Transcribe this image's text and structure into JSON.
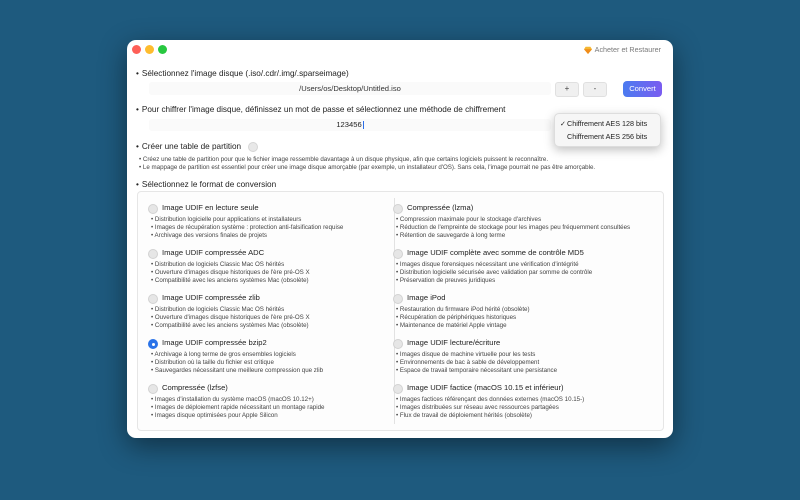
{
  "buy_restore": "Acheter et Restaurer",
  "disk": {
    "label": "Sélectionnez l'image disque (.iso/.cdr/.img/.sparseimage)",
    "path": "/Users/os/Desktop/Untitled.iso",
    "plus": "+",
    "minus": "-",
    "convert": "Convert"
  },
  "encryption": {
    "label": "Pour chiffrer l'image disque, définissez un mot de passe et sélectionnez une méthode de chiffrement",
    "password": "123456",
    "options": [
      "Chiffrement AES 128 bits",
      "Chiffrement AES 256 bits"
    ],
    "selected_mark": "✓"
  },
  "partition": {
    "label": "Créer une table de partition",
    "desc": [
      "Créez une table de partition pour que le fichier image ressemble davantage à un disque physique, afin que certains logiciels puissent le reconnaître.",
      "Le mappage de partition est essentiel pour créer une image disque amorçable (par exemple, un installateur d'OS). Sans cela, l'image pourrait ne pas être amorçable."
    ]
  },
  "format": {
    "label": "Sélectionnez le format de conversion",
    "left": [
      {
        "name": "Image UDIF en lecture seule",
        "selected": false,
        "lines": [
          "Distribution logicielle pour applications et installateurs",
          "Images de récupération système : protection anti-falsification requise",
          "Archivage des versions finales de projets"
        ]
      },
      {
        "name": "Image UDIF compressée ADC",
        "selected": false,
        "lines": [
          "Distribution de logiciels Classic Mac OS hérités",
          "Ouverture d'images disque historiques de l'ère pré-OS X",
          "Compatibilité avec les anciens systèmes Mac (obsolète)"
        ]
      },
      {
        "name": "Image UDIF compressée zlib",
        "selected": false,
        "lines": [
          "Distribution de logiciels Classic Mac OS hérités",
          "Ouverture d'images disque historiques de l'ère pré-OS X",
          "Compatibilité avec les anciens systèmes Mac (obsolète)"
        ]
      },
      {
        "name": "Image UDIF compressée bzip2",
        "selected": true,
        "lines": [
          "Archivage à long terme de gros ensembles logiciels",
          "Distribution où la taille du fichier est critique",
          "Sauvegardes nécessitant une meilleure compression que zlib"
        ]
      },
      {
        "name": "Compressée (lzfse)",
        "selected": false,
        "lines": [
          "Images d'installation du système macOS (macOS 10.12+)",
          "Images de déploiement rapide nécessitant un montage rapide",
          "Images disque optimisées pour Apple Silicon"
        ]
      }
    ],
    "right": [
      {
        "name": "Compressée (lzma)",
        "selected": false,
        "lines": [
          "Compression maximale pour le stockage d'archives",
          "Réduction de l'empreinte de stockage pour les images peu fréquemment consultées",
          "Rétention de sauvegarde à long terme"
        ]
      },
      {
        "name": "Image UDIF complète avec somme de contrôle MD5",
        "selected": false,
        "lines": [
          "Images disque forensiques nécessitant une vérification d'intégrité",
          "Distribution logicielle sécurisée avec validation par somme de contrôle",
          "Préservation de preuves juridiques"
        ]
      },
      {
        "name": "Image iPod",
        "selected": false,
        "lines": [
          "Restauration du firmware iPod hérité (obsolète)",
          "Récupération de périphériques historiques",
          "Maintenance de matériel Apple vintage"
        ]
      },
      {
        "name": "Image UDIF lecture/écriture",
        "selected": false,
        "lines": [
          "Images disque de machine virtuelle pour les tests",
          "Environnements de bac à sable de développement",
          "Espace de travail temporaire nécessitant une persistance"
        ]
      },
      {
        "name": "Image UDIF factice (macOS 10.15 et inférieur)",
        "selected": false,
        "lines": [
          "Images factices référençant des données externes (macOS 10.15-)",
          "Images distribuées sur réseau avec ressources partagées",
          "Flux de travail de déploiement hérités (obsolète)"
        ]
      }
    ]
  },
  "colors": {
    "accent": "#2a73e8",
    "background": "#1e5a7e"
  }
}
